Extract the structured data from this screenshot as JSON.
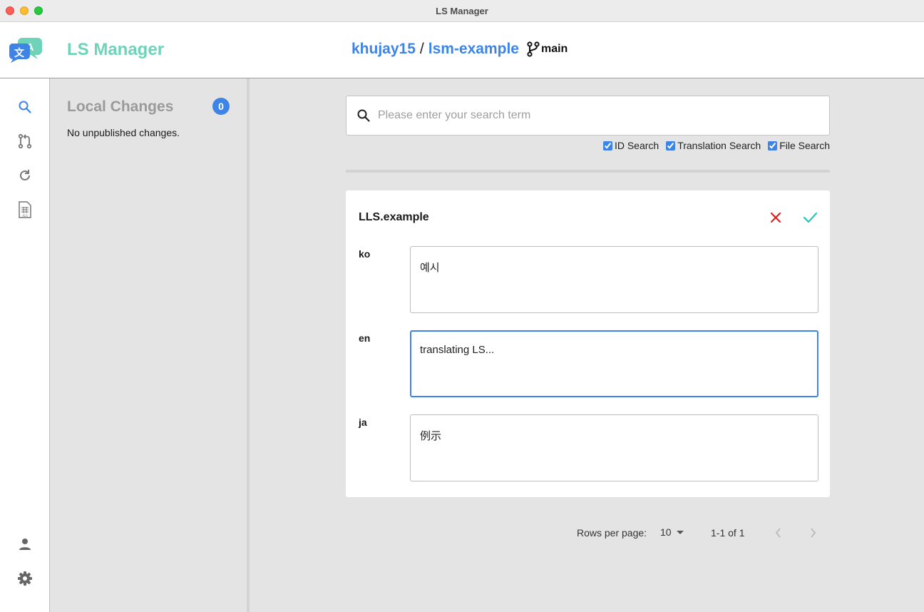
{
  "window": {
    "title": "LS Manager"
  },
  "header": {
    "app_name": "LS Manager",
    "repo_owner": "khujay15",
    "separator": "/",
    "repo_name": "lsm-example",
    "branch": "main"
  },
  "rail": {
    "top_icons": [
      "search-icon",
      "pull-request-icon",
      "refresh-icon",
      "spreadsheet-icon"
    ],
    "bottom_icons": [
      "user-icon",
      "gear-icon"
    ],
    "active_color": "#3d84e6"
  },
  "changes": {
    "title": "Local Changes",
    "count": "0",
    "empty_text": "No unpublished changes."
  },
  "search": {
    "placeholder": "Please enter your search term",
    "value": "",
    "filters": [
      {
        "label": "ID Search",
        "checked": true
      },
      {
        "label": "Translation Search",
        "checked": true
      },
      {
        "label": "File Search",
        "checked": true
      }
    ]
  },
  "entry": {
    "id": "LLS.example",
    "translations": [
      {
        "lang": "ko",
        "value": "예시"
      },
      {
        "lang": "en",
        "value": "translating LS..."
      },
      {
        "lang": "ja",
        "value": "例示"
      }
    ]
  },
  "pagination": {
    "rows_label": "Rows per page:",
    "rows_value": "10",
    "range": "1-1 of 1"
  },
  "colors": {
    "brand": "#6fd3b9",
    "accent": "#3d84e6",
    "cancel": "#e02020",
    "confirm": "#2bc4b4"
  }
}
